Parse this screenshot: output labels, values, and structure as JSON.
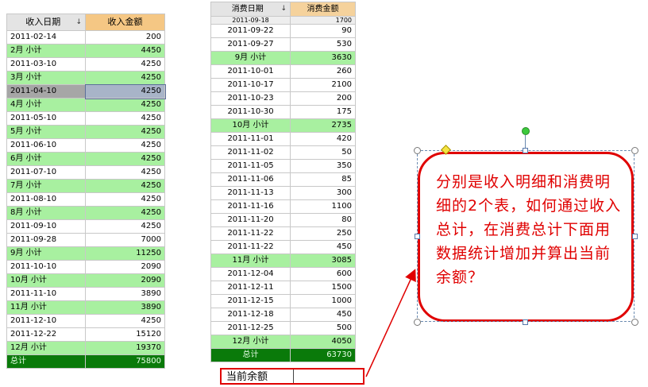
{
  "income": {
    "headers": [
      "收入日期",
      "收入金额"
    ],
    "sort_glyph": "↓",
    "rows": [
      {
        "d": "2011-02-14",
        "v": "200",
        "t": "row"
      },
      {
        "d": "2月 小计",
        "v": "4450",
        "t": "sub"
      },
      {
        "d": "2011-03-10",
        "v": "4250",
        "t": "row"
      },
      {
        "d": "3月 小计",
        "v": "4250",
        "t": "sub"
      },
      {
        "d": "2011-04-10",
        "v": "4250",
        "t": "hl"
      },
      {
        "d": "4月 小计",
        "v": "4250",
        "t": "sub"
      },
      {
        "d": "2011-05-10",
        "v": "4250",
        "t": "row"
      },
      {
        "d": "5月 小计",
        "v": "4250",
        "t": "sub"
      },
      {
        "d": "2011-06-10",
        "v": "4250",
        "t": "row"
      },
      {
        "d": "6月 小计",
        "v": "4250",
        "t": "sub"
      },
      {
        "d": "2011-07-10",
        "v": "4250",
        "t": "row"
      },
      {
        "d": "7月 小计",
        "v": "4250",
        "t": "sub"
      },
      {
        "d": "2011-08-10",
        "v": "4250",
        "t": "row"
      },
      {
        "d": "8月 小计",
        "v": "4250",
        "t": "sub"
      },
      {
        "d": "2011-09-10",
        "v": "4250",
        "t": "row"
      },
      {
        "d": "2011-09-28",
        "v": "7000",
        "t": "row"
      },
      {
        "d": "9月 小计",
        "v": "11250",
        "t": "sub"
      },
      {
        "d": "2011-10-10",
        "v": "2090",
        "t": "row"
      },
      {
        "d": "10月 小计",
        "v": "2090",
        "t": "sub"
      },
      {
        "d": "2011-11-10",
        "v": "3890",
        "t": "row"
      },
      {
        "d": "11月 小计",
        "v": "3890",
        "t": "sub"
      },
      {
        "d": "2011-12-10",
        "v": "4250",
        "t": "row"
      },
      {
        "d": "2011-12-22",
        "v": "15120",
        "t": "row"
      },
      {
        "d": "12月 小计",
        "v": "19370",
        "t": "sub"
      },
      {
        "d": "总计",
        "v": "75800",
        "t": "total"
      }
    ]
  },
  "expense": {
    "headers": [
      "消费日期",
      "消费金额"
    ],
    "sort_glyph": "↓",
    "partial_row": {
      "d": "2011-09-18",
      "v": "1700"
    },
    "rows": [
      {
        "d": "2011-09-22",
        "v": "90",
        "t": "row"
      },
      {
        "d": "2011-09-27",
        "v": "530",
        "t": "row"
      },
      {
        "d": "9月 小计",
        "v": "3630",
        "t": "sub"
      },
      {
        "d": "2011-10-01",
        "v": "260",
        "t": "row"
      },
      {
        "d": "2011-10-17",
        "v": "2100",
        "t": "row"
      },
      {
        "d": "2011-10-23",
        "v": "200",
        "t": "row"
      },
      {
        "d": "2011-10-30",
        "v": "175",
        "t": "row"
      },
      {
        "d": "10月 小计",
        "v": "2735",
        "t": "sub"
      },
      {
        "d": "2011-11-01",
        "v": "420",
        "t": "row"
      },
      {
        "d": "2011-11-02",
        "v": "50",
        "t": "row"
      },
      {
        "d": "2011-11-05",
        "v": "350",
        "t": "row"
      },
      {
        "d": "2011-11-06",
        "v": "85",
        "t": "row"
      },
      {
        "d": "2011-11-13",
        "v": "300",
        "t": "row"
      },
      {
        "d": "2011-11-16",
        "v": "1100",
        "t": "row"
      },
      {
        "d": "2011-11-20",
        "v": "80",
        "t": "row"
      },
      {
        "d": "2011-11-22",
        "v": "250",
        "t": "row"
      },
      {
        "d": "2011-11-22",
        "v": "450",
        "t": "row"
      },
      {
        "d": "11月 小计",
        "v": "3085",
        "t": "sub"
      },
      {
        "d": "2011-12-04",
        "v": "600",
        "t": "row"
      },
      {
        "d": "2011-12-11",
        "v": "1500",
        "t": "row"
      },
      {
        "d": "2011-12-15",
        "v": "1000",
        "t": "row"
      },
      {
        "d": "2011-12-18",
        "v": "450",
        "t": "row"
      },
      {
        "d": "2011-12-25",
        "v": "500",
        "t": "row"
      },
      {
        "d": "12月 小计",
        "v": "4050",
        "t": "sub"
      },
      {
        "d": "总计",
        "v": "63730",
        "t": "total"
      }
    ]
  },
  "balance": {
    "label": "当前余额"
  },
  "callout": {
    "text": "分别是收入明细和消费明细的2个表，如何通过收入总计，在消费总计下面用数据统计增加并算出当前余额？"
  },
  "colors": {
    "subtotal": "#a8f0a0",
    "total": "#0a7a0a",
    "annotation": "#e00000"
  }
}
